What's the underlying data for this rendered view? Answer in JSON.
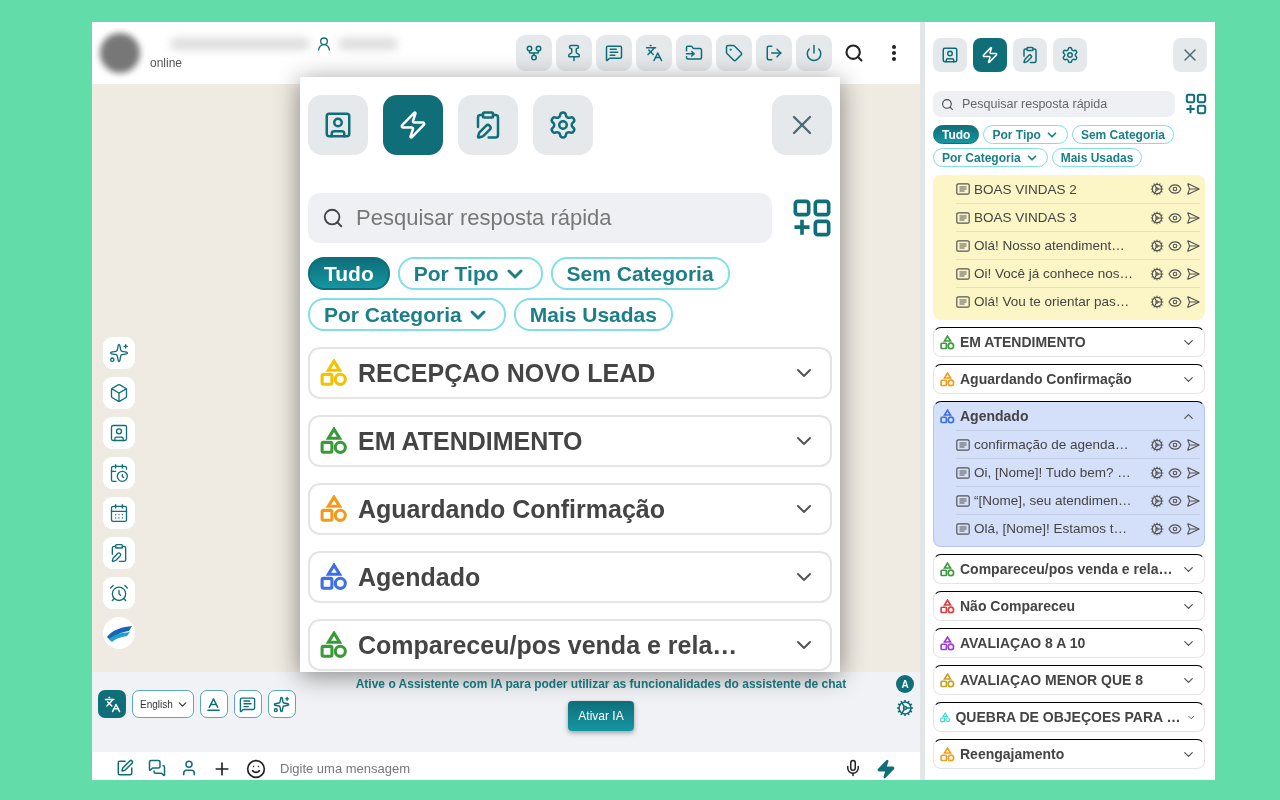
{
  "chat": {
    "status": "online"
  },
  "popup": {
    "tabs": [
      {
        "kind": "contact",
        "selected": false
      },
      {
        "kind": "quick",
        "selected": true
      },
      {
        "kind": "notes",
        "selected": false
      },
      {
        "kind": "settings",
        "selected": false
      }
    ],
    "search": {
      "placeholder": "Pesquisar resposta rápida"
    },
    "chips": [
      {
        "label": "Tudo",
        "selected": true,
        "dropdown": false
      },
      {
        "label": "Por Tipo",
        "selected": false,
        "dropdown": true
      },
      {
        "label": "Sem Categoria",
        "selected": false,
        "dropdown": false
      },
      {
        "label": "Por Categoria",
        "selected": false,
        "dropdown": true
      },
      {
        "label": "Mais Usadas",
        "selected": false,
        "dropdown": false
      }
    ],
    "categories": [
      {
        "name": "RECEPÇAO NOVO LEAD",
        "color": "#f2c200",
        "expanded": false
      },
      {
        "name": "EM ATENDIMENTO",
        "color": "#3a9a3a",
        "expanded": false
      },
      {
        "name": "Aguardando Confirmação",
        "color": "#f29a1a",
        "expanded": false
      },
      {
        "name": "Agendado",
        "color": "#3d6fe6",
        "expanded": false
      },
      {
        "name": "Compareceu/pos venda e rela…",
        "color": "#3a9a3a",
        "expanded": false
      }
    ]
  },
  "assistant": {
    "badge": "A",
    "language": "English",
    "notice": "Ative o Assistente com IA para poder utilizar as funcionalidades do assistente de chat",
    "button": "Ativar IA"
  },
  "composer": {
    "placeholder": "Digite uma mensagem"
  },
  "panel": {
    "tabs": [
      {
        "kind": "contact",
        "selected": false
      },
      {
        "kind": "quick",
        "selected": true
      },
      {
        "kind": "notes",
        "selected": false
      },
      {
        "kind": "settings",
        "selected": false
      }
    ],
    "search": {
      "placeholder": "Pesquisar resposta rápida"
    },
    "chips": [
      {
        "label": "Tudo",
        "selected": true,
        "dropdown": false
      },
      {
        "label": "Por Tipo",
        "selected": false,
        "dropdown": true
      },
      {
        "label": "Sem Categoria",
        "selected": false,
        "dropdown": false
      },
      {
        "label": "Por Categoria",
        "selected": false,
        "dropdown": true
      },
      {
        "label": "Mais Usadas",
        "selected": false,
        "dropdown": false
      }
    ],
    "groups": [
      {
        "color": "#fcf5c6",
        "expanded": true,
        "items": [
          "BOAS VINDAS 2",
          "BOAS VINDAS 3",
          "Olá! Nosso atendiment…",
          "Oi! Você já conhece nos…",
          "Olá! Vou te orientar pas…"
        ]
      },
      {
        "name": "EM ATENDIMENTO",
        "color": "#3a9a3a",
        "expanded": false
      },
      {
        "name": "Aguardando Confirmação",
        "color": "#f29a1a",
        "expanded": false
      },
      {
        "name": "Agendado",
        "color": "#3d6fe6",
        "expanded": true,
        "items": [
          "confirmação de agenda…",
          "Oi, [Nome]! Tudo bem? …",
          "“[Nome], seu atendimen…",
          "Olá, [Nome]! Estamos t…"
        ]
      },
      {
        "name": "Compareceu/pos venda e rela…",
        "color": "#3a9a3a",
        "expanded": false
      },
      {
        "name": "Não Compareceu",
        "color": "#e03a3a",
        "expanded": false
      },
      {
        "name": "AVALIAÇAO 8 A 10",
        "color": "#a33ad6",
        "expanded": false
      },
      {
        "name": "AVALIAÇAO MENOR QUE 8",
        "color": "#c8a020",
        "expanded": false
      },
      {
        "name": "QUEBRA DE OBJEÇOES PARA …",
        "color": "#3fd6c6",
        "expanded": false
      },
      {
        "name": "Reengajamento",
        "color": "#f0a020",
        "expanded": false
      }
    ]
  }
}
